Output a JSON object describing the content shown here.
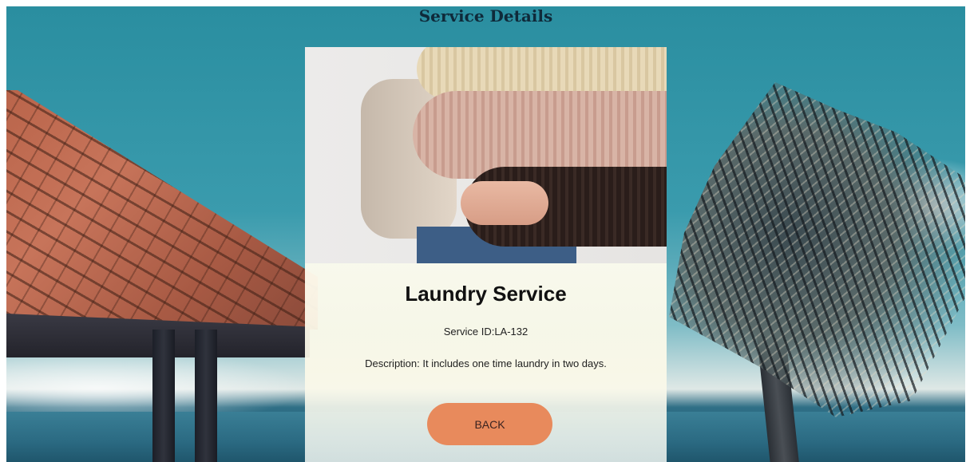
{
  "page": {
    "title": "Service Details"
  },
  "service": {
    "name": "Laundry Service",
    "id_label": "Service ID:",
    "id_value": "LA-132",
    "id_text": "Service ID:LA-132",
    "description_label": "Description:",
    "description_value": "It includes one time laundry in two days.",
    "description_text": "Description: It includes one time laundry in two days."
  },
  "actions": {
    "back_label": "BACK"
  },
  "colors": {
    "button": "#e88a5c",
    "title": "#0f2a3a",
    "card_body": "#fcf9e8"
  }
}
